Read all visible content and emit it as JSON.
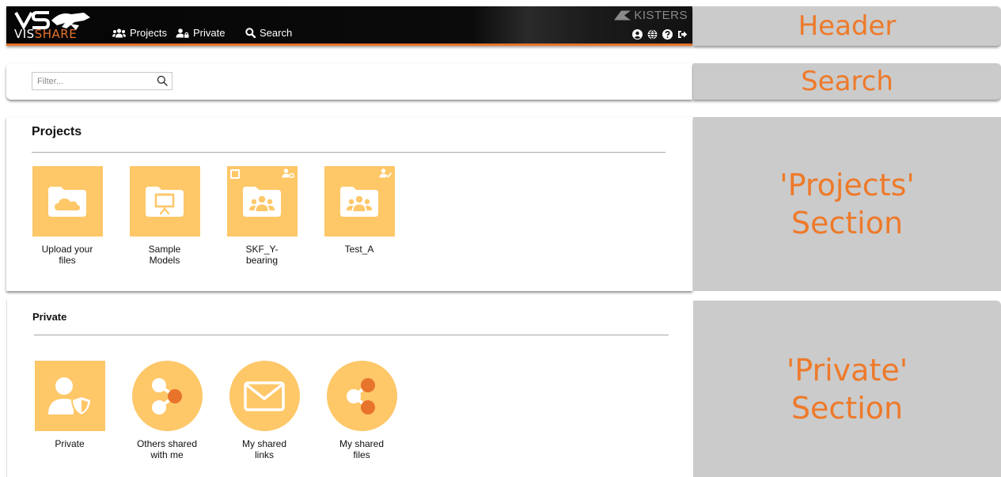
{
  "header": {
    "logo_text_main": "VIS",
    "logo_text_accent": "SHARE",
    "nav": {
      "projects_label": "Projects",
      "private_label": "Private",
      "search_label": "Search"
    },
    "brand": "KISTERS",
    "icons": [
      "user-circle-icon",
      "globe-icon",
      "help-icon",
      "logout-icon"
    ]
  },
  "search": {
    "placeholder": "Filter...",
    "value": ""
  },
  "projects": {
    "title": "Projects",
    "tiles": [
      {
        "label": "Upload your\nfiles",
        "icon": "cloud-folder-icon"
      },
      {
        "label": "Sample\nModels",
        "icon": "presentation-folder-icon"
      },
      {
        "label": "SKF_Y-\nbearing",
        "icon": "group-folder-icon",
        "badge": "user-settings-icon",
        "checkbox": true
      },
      {
        "label": "Test_A",
        "icon": "group-folder-icon",
        "badge": "user-check-icon"
      }
    ]
  },
  "private": {
    "title": "Private",
    "tiles": [
      {
        "label": "Private",
        "icon": "user-shield-icon"
      },
      {
        "label": "Others shared\nwith me",
        "icon": "share-received-icon"
      },
      {
        "label": "My shared\nlinks",
        "icon": "envelope-icon"
      },
      {
        "label": "My shared\nfiles",
        "icon": "share-icon"
      }
    ]
  },
  "callouts": {
    "header": "Header",
    "search": "Search",
    "projects": "'Projects'\nSection",
    "private": "'Private'\nSection"
  },
  "colors": {
    "accent": "#e8742c",
    "tile": "#fec768",
    "tile_dark": "#e8742c",
    "callout_bg": "#cbcbcb",
    "callout_text": "#ee7a2a"
  }
}
